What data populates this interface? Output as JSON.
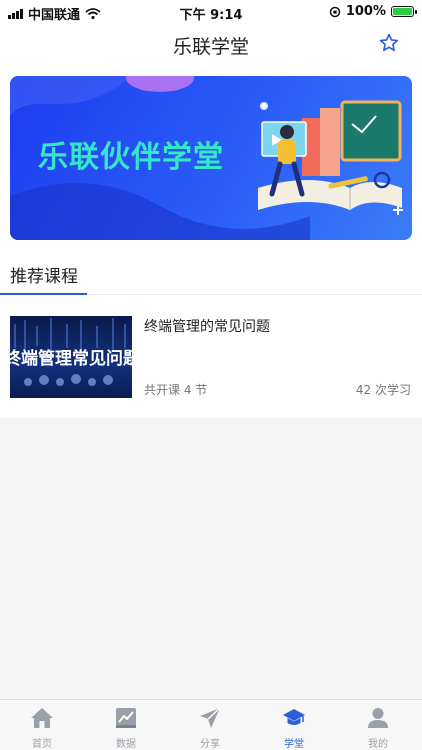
{
  "status_bar": {
    "carrier": "中国联通",
    "time": "下午 9:14",
    "battery": "100%"
  },
  "header": {
    "title": "乐联学堂",
    "favorite_icon": "star-outline-icon"
  },
  "banner": {
    "title": "乐联伙伴学堂"
  },
  "section": {
    "title": "推荐课程"
  },
  "courses": [
    {
      "title": "终端管理的常见问题",
      "thumbnail_text": "终端管理常见问题",
      "lessons": "共开课 4 节",
      "learners": "42 次学习"
    }
  ],
  "tab_bar": {
    "tabs": [
      {
        "label": "首页",
        "icon": "home-icon",
        "active": false
      },
      {
        "label": "数据",
        "icon": "chart-icon",
        "active": false
      },
      {
        "label": "分享",
        "icon": "paper-plane-icon",
        "active": false
      },
      {
        "label": "学堂",
        "icon": "graduation-cap-icon",
        "active": true
      },
      {
        "label": "我的",
        "icon": "user-icon",
        "active": false
      }
    ]
  },
  "colors": {
    "accent": "#2b5fd8",
    "inactive": "#9aa0aa",
    "banner_text": "#35e6c8"
  }
}
